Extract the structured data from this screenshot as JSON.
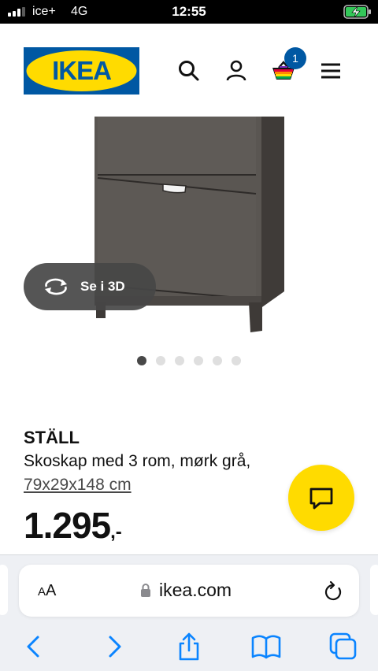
{
  "status_bar": {
    "carrier": "ice+",
    "network": "4G",
    "time": "12:55",
    "battery_charging": true
  },
  "header": {
    "logo_text": "IKEA",
    "cart_count": "1",
    "icons": [
      "search-icon",
      "profile-icon",
      "shopping-bag-icon",
      "hamburger-menu-icon"
    ]
  },
  "gallery": {
    "view_3d_label": "Se i 3D",
    "image_count": 6,
    "active_index": 0
  },
  "product": {
    "name": "STÄLL",
    "description": "Skoskap med 3 rom, mørk grå,",
    "size": "79x29x148 cm",
    "price": "1.295",
    "price_suffix": ",-"
  },
  "browser": {
    "text_size_label_small": "A",
    "text_size_label_large": "A",
    "url": "ikea.com",
    "toolbar": [
      "back-icon",
      "forward-icon",
      "share-icon",
      "bookmarks-icon",
      "tabs-icon"
    ]
  },
  "colors": {
    "ikea_blue": "#0058a3",
    "ikea_yellow": "#ffdb00",
    "ios_blue": "#0a84ff"
  }
}
